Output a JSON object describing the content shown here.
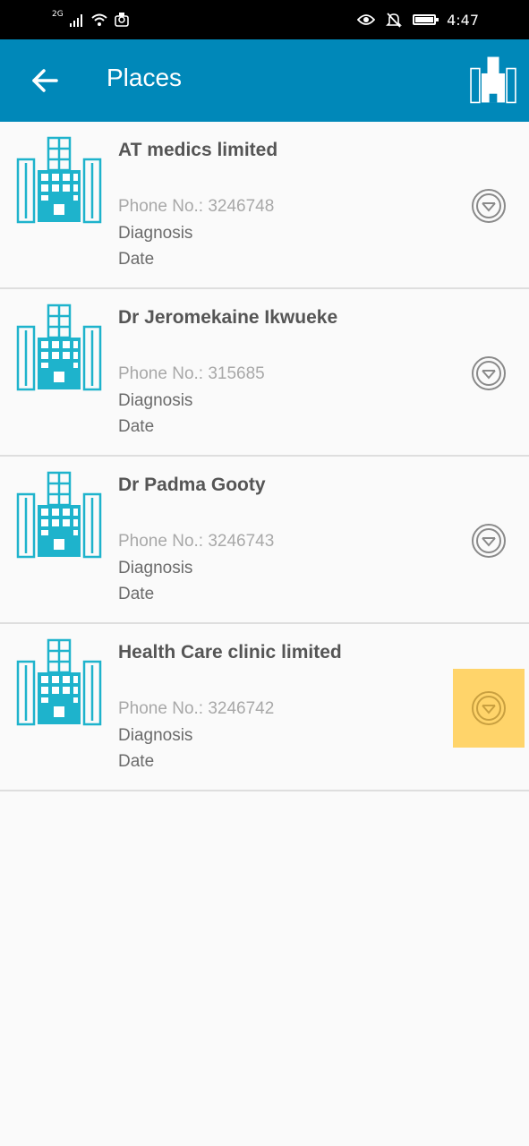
{
  "status_bar": {
    "network": "2G",
    "time": "4:47"
  },
  "app_bar": {
    "title": "Places"
  },
  "places": [
    {
      "name": "AT medics limited",
      "phone": "Phone No.: 3246748",
      "diagnosis": "Diagnosis",
      "date": "Date",
      "highlighted": false
    },
    {
      "name": "Dr Jeromekaine Ikwueke",
      "phone": "Phone No.: 315685",
      "diagnosis": "Diagnosis",
      "date": "Date",
      "highlighted": false
    },
    {
      "name": "Dr Padma Gooty",
      "phone": "Phone No.: 3246743",
      "diagnosis": "Diagnosis",
      "date": "Date",
      "highlighted": false
    },
    {
      "name": "Health Care clinic limited",
      "phone": "Phone No.: 3246742",
      "diagnosis": "Diagnosis",
      "date": "Date",
      "highlighted": true
    }
  ],
  "colors": {
    "app_bar": "#0088b9",
    "building_icon": "#1eb3cc",
    "highlight": "#ffd46a"
  },
  "icons": {
    "back": "arrow-left-icon",
    "app_logo": "hospital-building-icon",
    "place": "hospital-building-icon",
    "expand": "chevron-down-circle-icon"
  }
}
